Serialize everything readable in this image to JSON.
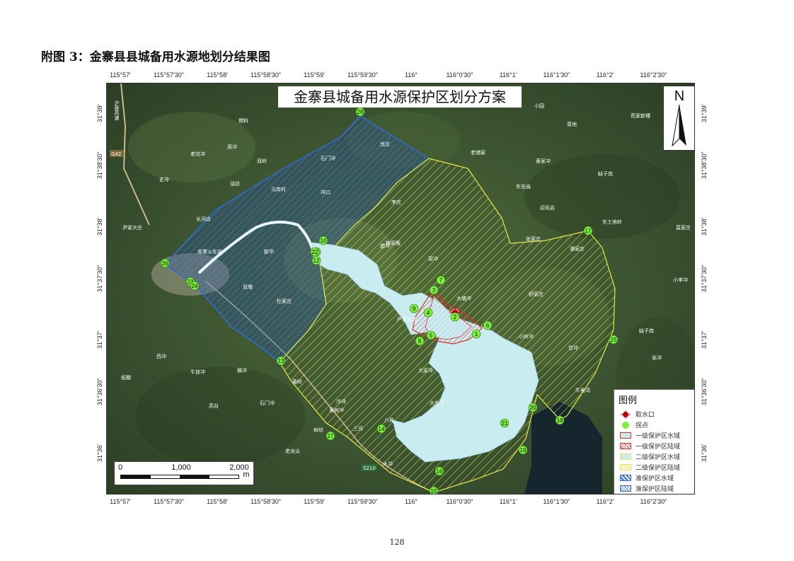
{
  "page": {
    "title": "附图 3：金寨县县城备用水源地划分结果图",
    "page_number": "128"
  },
  "map": {
    "heading": "金寨县城备用水源保护区划分方案",
    "north_label": "N",
    "x_ticks": [
      "115°57'",
      "115°57'30\"",
      "115°58'",
      "115°58'30\"",
      "115°59'",
      "115°59'30\"",
      "116°",
      "116°0'30\"",
      "116°1'",
      "116°1'30\"",
      "116°2'",
      "116°2'30\""
    ],
    "y_ticks": [
      "31°39'",
      "31°38'30\"",
      "31°38'",
      "31°37'30\"",
      "31°37'",
      "31°36'30\"",
      "31°36'"
    ],
    "points": [
      "1",
      "2",
      "3",
      "4",
      "5",
      "6",
      "7",
      "8",
      "9",
      "10",
      "11",
      "12",
      "13",
      "14",
      "15",
      "16",
      "17",
      "18",
      "19",
      "20",
      "21",
      "22",
      "23",
      "24",
      "25",
      "26",
      "27",
      "28"
    ],
    "place_names": [
      "燃料",
      "双岭",
      "周冲",
      "老坟冲",
      "史冲",
      "油坊",
      "马岸村",
      "石门冲",
      "冲口",
      "伐庄",
      "老储家",
      "黄家冲",
      "菜地",
      "东岳庙",
      "迎风岩",
      "张家庄",
      "东土地岭",
      "莫家庄",
      "李庄",
      "潘家庄",
      "尹家大庄",
      "长河店",
      "金寨火车站",
      "新华",
      "双墩",
      "杜家庄",
      "大塘冲",
      "小岭冲",
      "舒家庄",
      "缺子岗",
      "甘冲",
      "牛角湾",
      "黄岭",
      "石门冲",
      "老龙尖",
      "树坊",
      "严家大冲",
      "梅家畈",
      "小李冲",
      "梁冲",
      "大家冲",
      "腊冲",
      "大庄子",
      "八户",
      "横冲",
      "牛放冲",
      "高台",
      "纸棚",
      "西冲",
      "黄树冲",
      "冷冲",
      "三河",
      "大冲",
      "张冲",
      "小园",
      "荒家新槽",
      "缺子岗"
    ],
    "road_labels": [
      "沪蓉高速",
      "G42",
      "S210"
    ]
  },
  "legend": {
    "title": "图例",
    "items": [
      {
        "label": "取水口",
        "symbol": "intake"
      },
      {
        "label": "拐点",
        "symbol": "point"
      },
      {
        "label": "一级保护区水域",
        "symbol": "level1-water"
      },
      {
        "label": "一级保护区陆域",
        "symbol": "level1-land"
      },
      {
        "label": "二级保护区水域",
        "symbol": "level2-water"
      },
      {
        "label": "二级保护区陆域",
        "symbol": "level2-land"
      },
      {
        "label": "准保护区水域",
        "symbol": "quasi-water"
      },
      {
        "label": "准保护区陆域",
        "symbol": "quasi-land"
      }
    ]
  },
  "scale": {
    "labels": [
      "0",
      "1,000",
      "2,000"
    ],
    "unit": "m"
  },
  "colors": {
    "level1": "#e03030",
    "level2": "#e8e84a",
    "quasi": "#2f6ad8",
    "water": "#c8ecf0",
    "point": "#7cf03a",
    "terrain": "#3d5a2c"
  }
}
